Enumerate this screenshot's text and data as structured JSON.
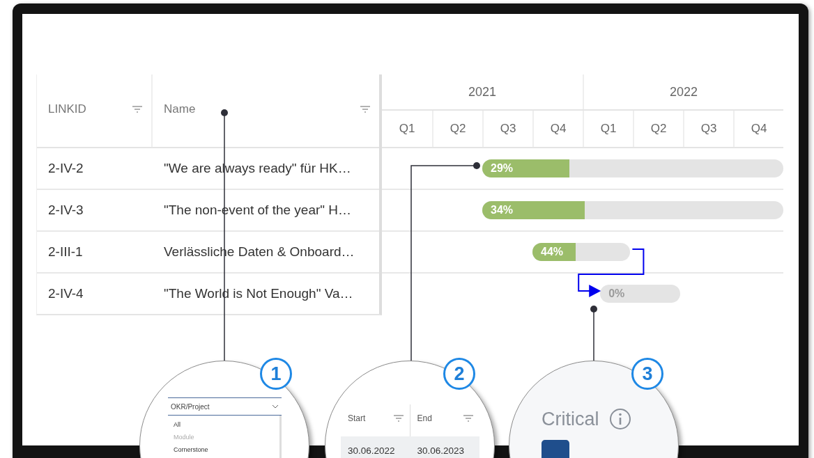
{
  "table": {
    "columns": [
      {
        "label": "LINKID"
      },
      {
        "label": "Name"
      }
    ],
    "rows": [
      {
        "linkid": "2-IV-2",
        "name": "\"We are always ready\" für HK…"
      },
      {
        "linkid": "2-IV-3",
        "name": "\"The non-event of the year\" H…"
      },
      {
        "linkid": "2-III-1",
        "name": "Verlässliche Daten & Onboard…"
      },
      {
        "linkid": "2-IV-4",
        "name": "\"The World is Not Enough\" Va…"
      }
    ]
  },
  "timeline": {
    "years": [
      "2021",
      "2022"
    ],
    "quarters": [
      "Q1",
      "Q2",
      "Q3",
      "Q4",
      "Q1",
      "Q2",
      "Q3",
      "Q4"
    ]
  },
  "bars": [
    {
      "label": "29%",
      "level": 0.29,
      "links_to_next": false
    },
    {
      "label": "34%",
      "level": 0.34,
      "links_to_next": false
    },
    {
      "label": "44%",
      "level": 0.44,
      "links_to_next": true
    },
    {
      "label": "0%",
      "level": 0,
      "links_to_next": false
    }
  ],
  "callouts": [
    {
      "number": "1",
      "kind": "dropdown",
      "field": "OKR/Project",
      "options": [
        {
          "label": "All",
          "disabled": false
        },
        {
          "label": "Module",
          "disabled": true
        },
        {
          "label": "Cornerstone",
          "disabled": false
        }
      ]
    },
    {
      "number": "2",
      "kind": "dates",
      "columns": [
        "Start",
        "End"
      ],
      "row": [
        "30.06.2022",
        "30.06.2023"
      ]
    },
    {
      "number": "3",
      "kind": "critical",
      "label": "Critical",
      "checked": true
    }
  ]
}
